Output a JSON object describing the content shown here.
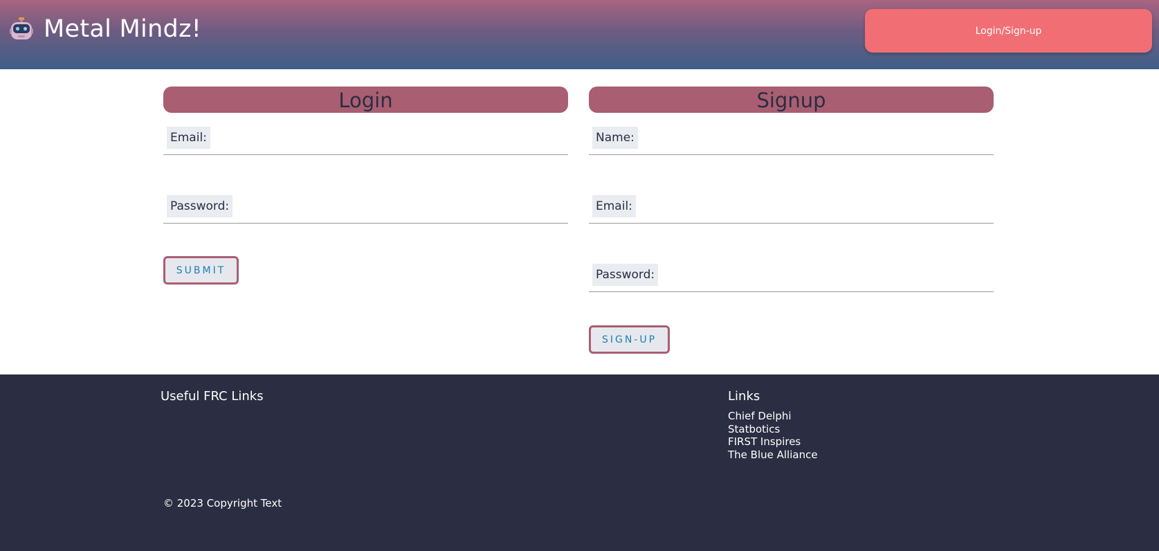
{
  "header": {
    "brand": "Metal Mindz!",
    "logo_icon": "robot-icon",
    "login_button": "Login/Sign-up",
    "colors": {
      "gradient_top": "#a86480",
      "gradient_bottom": "#3c5f88",
      "login_button_bg": "#f06e74"
    }
  },
  "login": {
    "title": "Login",
    "fields": [
      {
        "label": "Email:",
        "value": ""
      },
      {
        "label": "Password:",
        "value": ""
      }
    ],
    "submit_label": "SUBMIT"
  },
  "signup": {
    "title": "Signup",
    "fields": [
      {
        "label": "Name:",
        "value": ""
      },
      {
        "label": "Email:",
        "value": ""
      },
      {
        "label": "Password:",
        "value": ""
      }
    ],
    "submit_label": "SIGN-UP"
  },
  "theme": {
    "panel_title_bg": "#a95e72",
    "button_text": "#1c7fb5",
    "footer_bg": "#2b2d42"
  },
  "footer": {
    "useful_heading": "Useful FRC Links",
    "links_heading": "Links",
    "links": [
      "Chief Delphi",
      "Statbotics",
      "FIRST Inspires",
      "The Blue Alliance"
    ],
    "copyright": "© 2023 Copyright Text"
  }
}
